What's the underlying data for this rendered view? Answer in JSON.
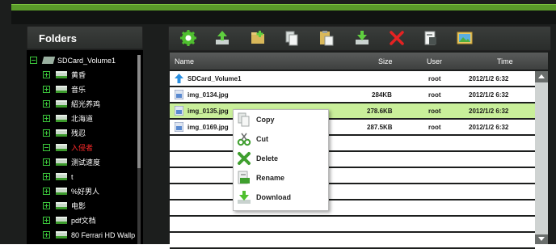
{
  "folders_panel": {
    "title": "Folders",
    "root": "SDCard_Volume1",
    "items": [
      {
        "label": "黄昏",
        "red": false
      },
      {
        "label": "音乐",
        "red": false
      },
      {
        "label": "紹光养鸡",
        "red": false
      },
      {
        "label": "北海道",
        "red": false
      },
      {
        "label": "残忍",
        "red": false
      },
      {
        "label": "入侵者",
        "red": true
      },
      {
        "label": "测试速度",
        "red": false
      },
      {
        "label": "t",
        "red": false
      },
      {
        "label": "%好男人",
        "red": false
      },
      {
        "label": "电影",
        "red": false
      },
      {
        "label": "pdf文档",
        "red": false
      },
      {
        "label": "80 Ferrari HD Wallp",
        "red": false
      }
    ]
  },
  "toolbar": {
    "buttons": [
      {
        "name": "settings",
        "icon": "gear-icon"
      },
      {
        "name": "upload",
        "icon": "upload-icon"
      },
      {
        "name": "new-folder",
        "icon": "new-folder-icon"
      },
      {
        "name": "copy",
        "icon": "copy-icon"
      },
      {
        "name": "paste",
        "icon": "paste-icon"
      },
      {
        "name": "download",
        "icon": "download-icon"
      },
      {
        "name": "delete",
        "icon": "delete-icon"
      },
      {
        "name": "rename",
        "icon": "rename-icon"
      },
      {
        "name": "preview",
        "icon": "image-icon"
      }
    ]
  },
  "table": {
    "columns": {
      "name": "Name",
      "size": "Size",
      "user": "User",
      "time": "Time"
    },
    "rows": [
      {
        "name": "SDCard_Volume1",
        "size": "",
        "user": "root",
        "time": "2012/1/2 6:32",
        "type": "parent",
        "selected": false
      },
      {
        "name": "img_0134.jpg",
        "size": "284KB",
        "user": "root",
        "time": "2012/1/2 6:32",
        "type": "file",
        "selected": false
      },
      {
        "name": "img_0135.jpg",
        "size": "278.6KB",
        "user": "root",
        "time": "2012/1/2 6:32",
        "type": "file",
        "selected": true
      },
      {
        "name": "img_0169.jpg",
        "size": "287.5KB",
        "user": "root",
        "time": "2012/1/2 6:32",
        "type": "file",
        "selected": false
      }
    ]
  },
  "context_menu": {
    "items": [
      {
        "label": "Copy",
        "icon": "copy-icon"
      },
      {
        "label": "Cut",
        "icon": "scissors-icon"
      },
      {
        "label": "Delete",
        "icon": "delete-icon"
      },
      {
        "label": "Rename",
        "icon": "rename-icon"
      },
      {
        "label": "Download",
        "icon": "download-icon"
      }
    ]
  },
  "colors": {
    "accent_green": "#5a9a2a",
    "selection": "#c9ef9a",
    "background": "#1c1e1d"
  }
}
